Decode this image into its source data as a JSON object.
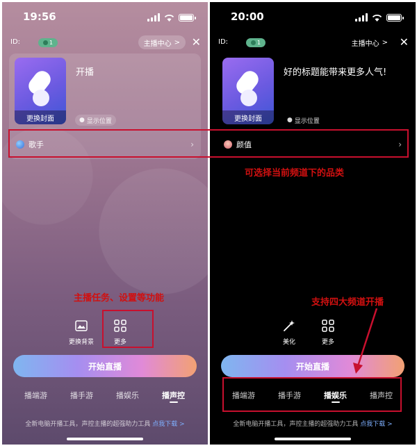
{
  "left": {
    "status": {
      "time": "19:56"
    },
    "topbar": {
      "id_label": "ID:",
      "badge": "1",
      "center_label": "主播中心",
      "chevron": ">",
      "close": "✕"
    },
    "cover_label": "更换封面",
    "title": "开播",
    "location": "显示位置",
    "category": "歌手",
    "tools": [
      {
        "label": "更换背景",
        "icon": "image-icon"
      },
      {
        "label": "更多",
        "icon": "grid-icon"
      }
    ],
    "start_label": "开始直播",
    "tabs": [
      "播端游",
      "播手游",
      "播娱乐",
      "播声控"
    ],
    "active_tab": 3,
    "footer": {
      "text": "全新电脑开播工具，声控主播的超强助力工具",
      "link": "点我下载 >"
    }
  },
  "right": {
    "status": {
      "time": "20:00"
    },
    "topbar": {
      "id_label": "ID:",
      "badge": "1",
      "center_label": "主播中心",
      "chevron": ">",
      "close": "✕"
    },
    "cover_label": "更换封面",
    "title": "好的标题能带来更多人气!",
    "location": "显示位置",
    "category": "颜值",
    "tools": [
      {
        "label": "美化",
        "icon": "magic-wand-icon"
      },
      {
        "label": "更多",
        "icon": "grid-icon"
      }
    ],
    "start_label": "开始直播",
    "tabs": [
      "播端游",
      "播手游",
      "播娱乐",
      "播声控"
    ],
    "active_tab": 2,
    "footer": {
      "text": "全新电脑开播工具，声控主播的超强助力工具",
      "link": "点我下载 >"
    }
  },
  "annotations": {
    "category_note": "可选择当前频道下的品类",
    "more_note": "主播任务、设置等功能",
    "channels_note": "支持四大频道开播"
  },
  "colors": {
    "annotation": "#c8102e",
    "link": "#7fb0ff",
    "badge": "#5fb38d"
  }
}
